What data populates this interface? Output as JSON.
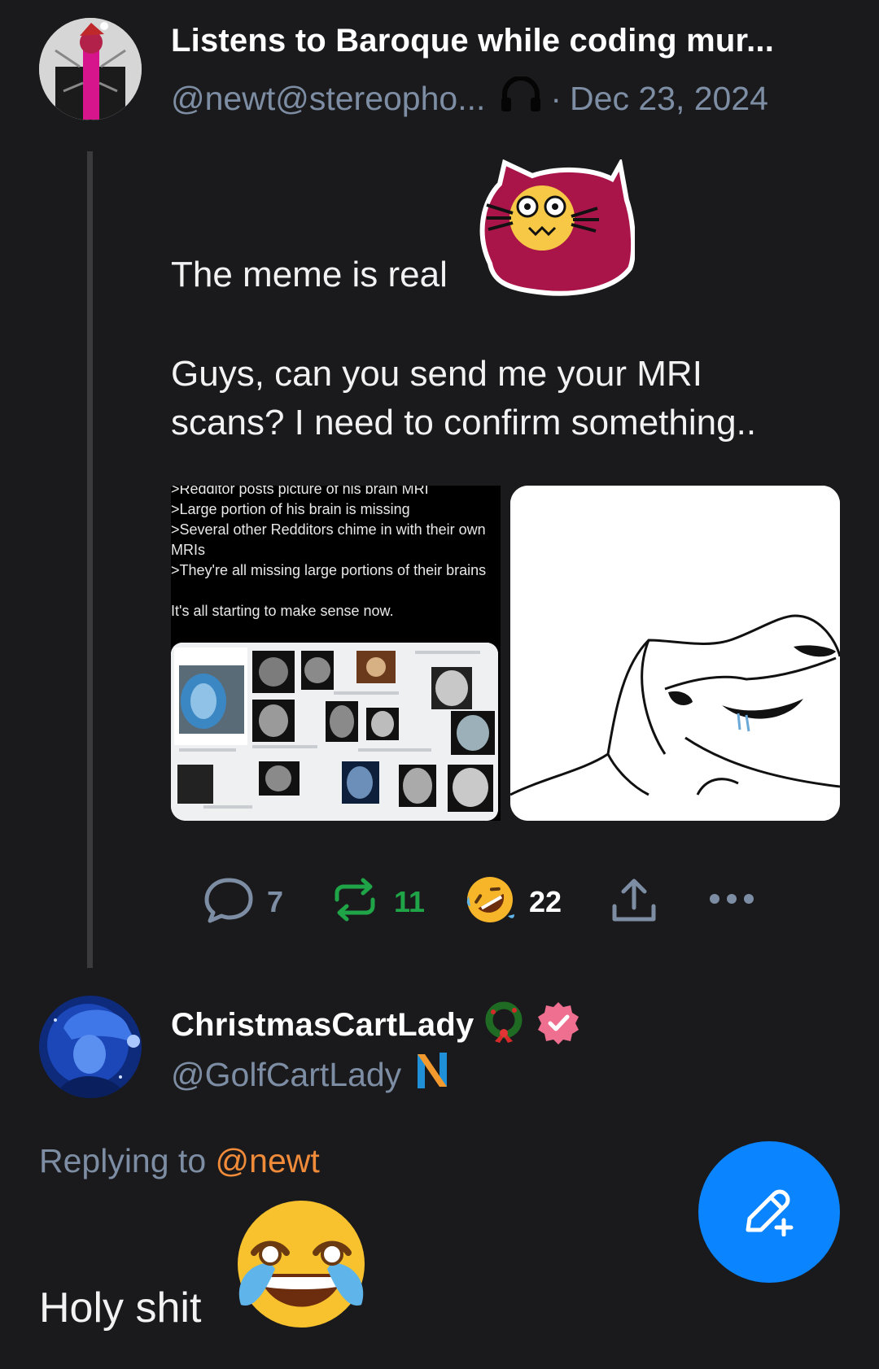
{
  "post": {
    "author_name": "Listens to Baroque while coding mur...",
    "handle": "@newt@stereopho...",
    "date_separator": "·",
    "date": "Dec 23, 2024",
    "line1": "The meme is real",
    "line2": "Guys, can you send me your MRI",
    "line3": "scans? I need to confirm something..",
    "media_left": {
      "lines": [
        ">Redditor posts picture of his brain MRI",
        ">Large portion of his brain is missing",
        ">Several other Redditors chime in with their own",
        "MRIs",
        ">They're all missing large portions of their brains",
        "",
        "It's all starting to make sense now."
      ]
    },
    "stats": {
      "replies": "7",
      "boosts": "11",
      "reactions": "22"
    }
  },
  "reply": {
    "author_name": "ChristmasCartLady",
    "handle": "@GolfCartLady",
    "replying_prefix": "Replying to",
    "replying_handle": "@newt",
    "text": "Holy shit"
  },
  "colors": {
    "background": "#1a1a1c",
    "handle": "#7d8da3",
    "boost": "#1fa447",
    "mention": "#f08b3a",
    "fab": "#0a84ff"
  },
  "icons": {
    "reply": "speech-bubble-icon",
    "boost": "repeat-icon",
    "reaction": "rofl-emoji-icon",
    "share": "share-upload-icon",
    "more": "more-dots-icon",
    "compose": "pencil-plus-icon",
    "headphones": "headphones-icon"
  }
}
